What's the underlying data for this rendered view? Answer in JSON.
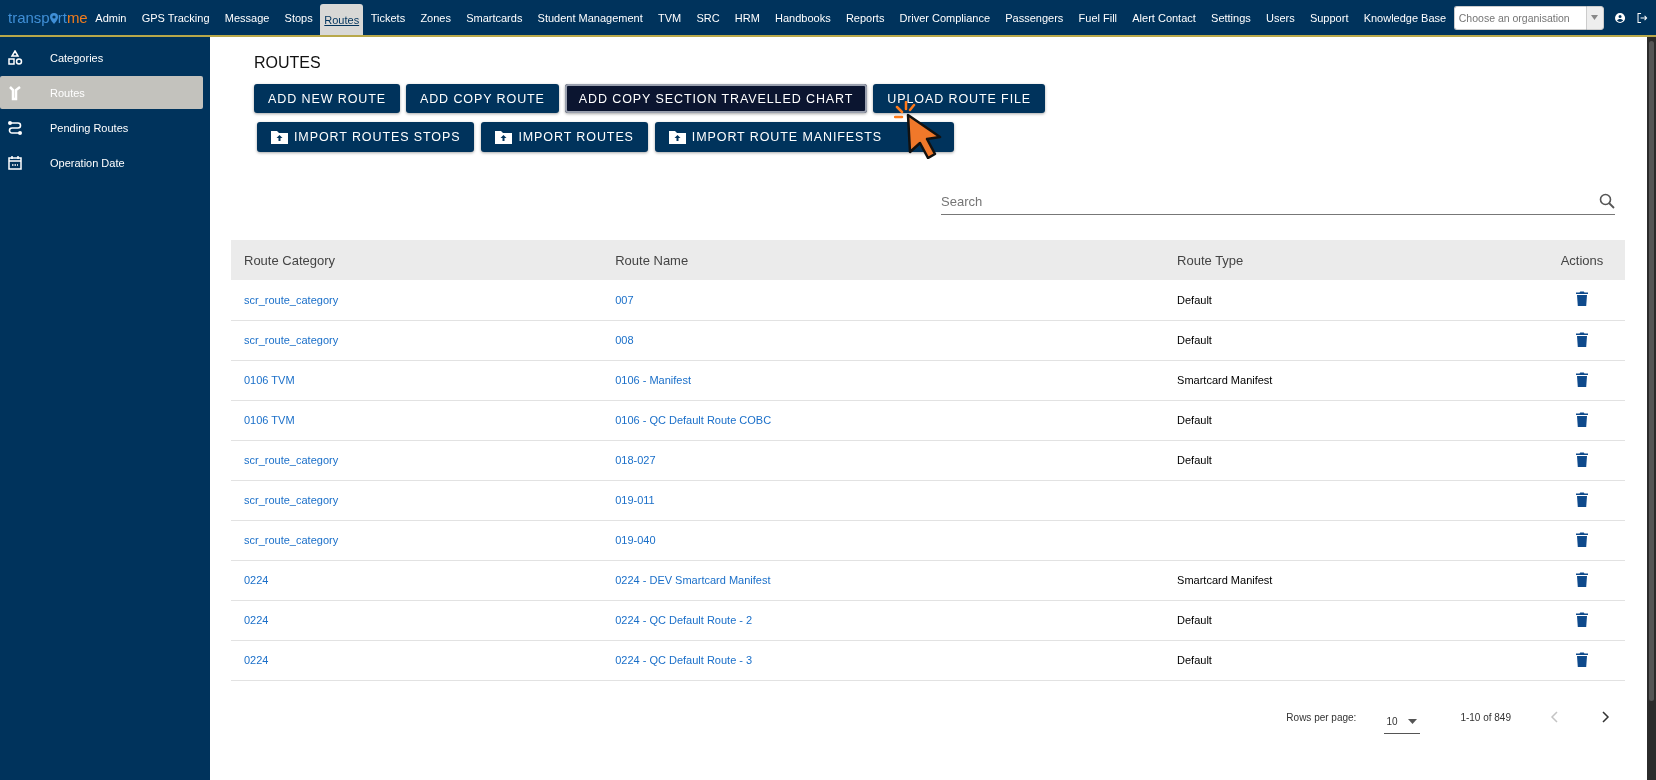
{
  "topbar": {
    "logo": {
      "part_1": "transp",
      "part_2": "rt",
      "part_3": "me"
    },
    "nav": [
      {
        "label": "Admin",
        "selected": false
      },
      {
        "label": "GPS Tracking",
        "selected": false
      },
      {
        "label": "Message",
        "selected": false
      },
      {
        "label": "Stops",
        "selected": false
      },
      {
        "label": "Routes",
        "selected": true
      },
      {
        "label": "Tickets",
        "selected": false
      },
      {
        "label": "Zones",
        "selected": false
      },
      {
        "label": "Smartcards",
        "selected": false
      },
      {
        "label": "Student Management",
        "selected": false
      },
      {
        "label": "TVM",
        "selected": false
      },
      {
        "label": "SRC",
        "selected": false
      },
      {
        "label": "HRM",
        "selected": false
      },
      {
        "label": "Handbooks",
        "selected": false
      },
      {
        "label": "Reports",
        "selected": false
      },
      {
        "label": "Driver Compliance",
        "selected": false
      },
      {
        "label": "Passengers",
        "selected": false
      },
      {
        "label": "Fuel Fill",
        "selected": false
      },
      {
        "label": "Alert Contact",
        "selected": false
      },
      {
        "label": "Settings",
        "selected": false
      },
      {
        "label": "Users",
        "selected": false
      },
      {
        "label": "Support",
        "selected": false
      },
      {
        "label": "Knowledge Base",
        "selected": false
      }
    ],
    "organisation": {
      "placeholder": "Choose an organisation"
    }
  },
  "sidebar": {
    "items": [
      {
        "label": "Categories",
        "selected": false
      },
      {
        "label": "Routes",
        "selected": true
      },
      {
        "label": "Pending Routes",
        "selected": false
      },
      {
        "label": "Operation Date",
        "selected": false
      }
    ]
  },
  "page": {
    "title": "ROUTES",
    "buttons": [
      {
        "label": "ADD NEW ROUTE",
        "focused": false
      },
      {
        "label": "ADD COPY ROUTE",
        "focused": false
      },
      {
        "label": "ADD COPY SECTION TRAVELLED CHART",
        "focused": true
      },
      {
        "label": "UPLOAD ROUTE FILE",
        "focused": false
      }
    ],
    "import_buttons": [
      {
        "label": "IMPORT ROUTES STOPS",
        "focused": false
      },
      {
        "label": "IMPORT ROUTES",
        "focused": false
      },
      {
        "label": "IMPORT ROUTE MANIFESTS",
        "focused": false
      }
    ],
    "search": {
      "placeholder": "Search"
    },
    "table": {
      "columns": [
        "Route Category",
        "Route Name",
        "Route Type",
        "Actions"
      ],
      "rows": [
        {
          "category": "scr_route_category",
          "name": "007",
          "type": "Default"
        },
        {
          "category": "scr_route_category",
          "name": "008",
          "type": "Default"
        },
        {
          "category": "0106 TVM",
          "name": "0106 - Manifest",
          "type": "Smartcard Manifest"
        },
        {
          "category": "0106 TVM",
          "name": "0106 - QC Default Route COBC",
          "type": "Default"
        },
        {
          "category": "scr_route_category",
          "name": "018-027",
          "type": "Default"
        },
        {
          "category": "scr_route_category",
          "name": "019-011"
        },
        {
          "category": "scr_route_category",
          "name": "019-040"
        },
        {
          "category": "0224",
          "name": "0224 - DEV Smartcard Manifest",
          "type": "Smartcard Manifest"
        },
        {
          "category": "0224",
          "name": "0224 - QC Default Route - 2",
          "type": "Default"
        },
        {
          "category": "0224",
          "name": "0224 - QC Default Route - 3",
          "type": "Default"
        }
      ]
    },
    "pagination": {
      "rows_per_page_label": "Rows per page:",
      "rows_per_page": "10",
      "range": "1-10 of 849",
      "previous_disabled": true,
      "next_disabled": false
    }
  }
}
